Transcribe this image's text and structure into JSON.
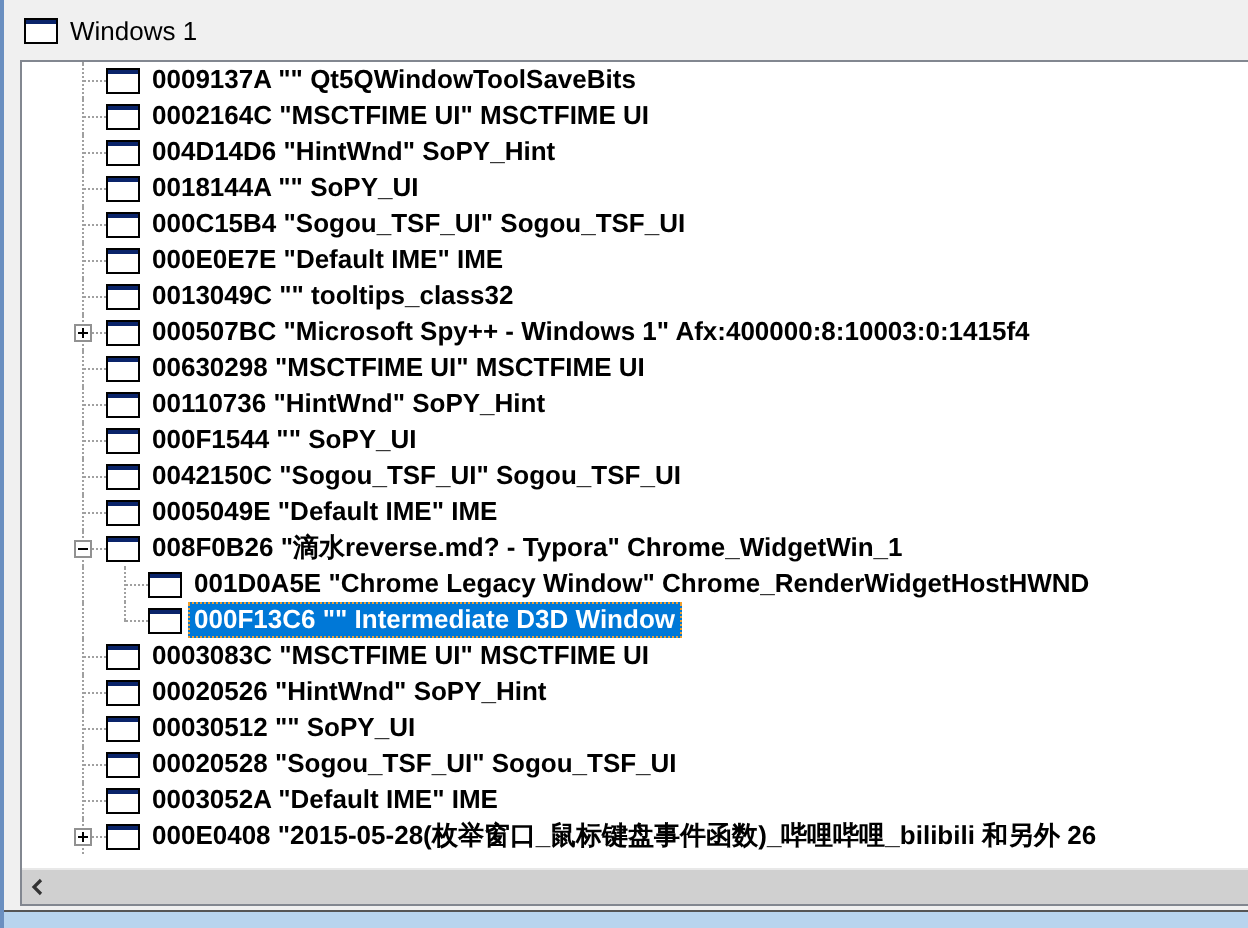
{
  "window": {
    "title": "Windows 1"
  },
  "tree": [
    {
      "kind": "leaf",
      "text": "0009137A \"\" Qt5QWindowToolSaveBits",
      "selected": false
    },
    {
      "kind": "leaf",
      "text": "0002164C \"MSCTFIME UI\" MSCTFIME UI",
      "selected": false
    },
    {
      "kind": "leaf",
      "text": "004D14D6 \"HintWnd\" SoPY_Hint",
      "selected": false
    },
    {
      "kind": "leaf",
      "text": "0018144A \"\" SoPY_UI",
      "selected": false
    },
    {
      "kind": "leaf",
      "text": "000C15B4 \"Sogou_TSF_UI\" Sogou_TSF_UI",
      "selected": false
    },
    {
      "kind": "leaf",
      "text": "000E0E7E \"Default IME\" IME",
      "selected": false
    },
    {
      "kind": "leaf",
      "text": "0013049C \"\" tooltips_class32",
      "selected": false
    },
    {
      "kind": "parent",
      "expanded": false,
      "text": "000507BC \"Microsoft Spy++ - Windows 1\" Afx:400000:8:10003:0:1415f4",
      "selected": false
    },
    {
      "kind": "leaf",
      "text": "00630298 \"MSCTFIME UI\" MSCTFIME UI",
      "selected": false
    },
    {
      "kind": "leaf",
      "text": "00110736 \"HintWnd\" SoPY_Hint",
      "selected": false
    },
    {
      "kind": "leaf",
      "text": "000F1544 \"\" SoPY_UI",
      "selected": false
    },
    {
      "kind": "leaf",
      "text": "0042150C \"Sogou_TSF_UI\" Sogou_TSF_UI",
      "selected": false
    },
    {
      "kind": "leaf",
      "text": "0005049E \"Default IME\" IME",
      "selected": false
    },
    {
      "kind": "parent",
      "expanded": true,
      "text": "008F0B26 \"滴水reverse.md? - Typora\" Chrome_WidgetWin_1",
      "selected": false,
      "children": [
        {
          "kind": "leaf",
          "text": "001D0A5E \"Chrome Legacy Window\" Chrome_RenderWidgetHostHWND",
          "selected": false
        },
        {
          "kind": "leaf",
          "text": "000F13C6 \"\" Intermediate D3D Window",
          "selected": true
        }
      ]
    },
    {
      "kind": "leaf",
      "text": "0003083C \"MSCTFIME UI\" MSCTFIME UI",
      "selected": false
    },
    {
      "kind": "leaf",
      "text": "00020526 \"HintWnd\" SoPY_Hint",
      "selected": false
    },
    {
      "kind": "leaf",
      "text": "00030512 \"\" SoPY_UI",
      "selected": false
    },
    {
      "kind": "leaf",
      "text": "00020528 \"Sogou_TSF_UI\" Sogou_TSF_UI",
      "selected": false
    },
    {
      "kind": "leaf",
      "text": "0003052A \"Default IME\" IME",
      "selected": false
    },
    {
      "kind": "parent",
      "expanded": false,
      "text": "000E0408 \"2015-05-28(枚举窗口_鼠标键盘事件函数)_哔哩哔哩_bilibili 和另外 26",
      "selected": false
    }
  ]
}
